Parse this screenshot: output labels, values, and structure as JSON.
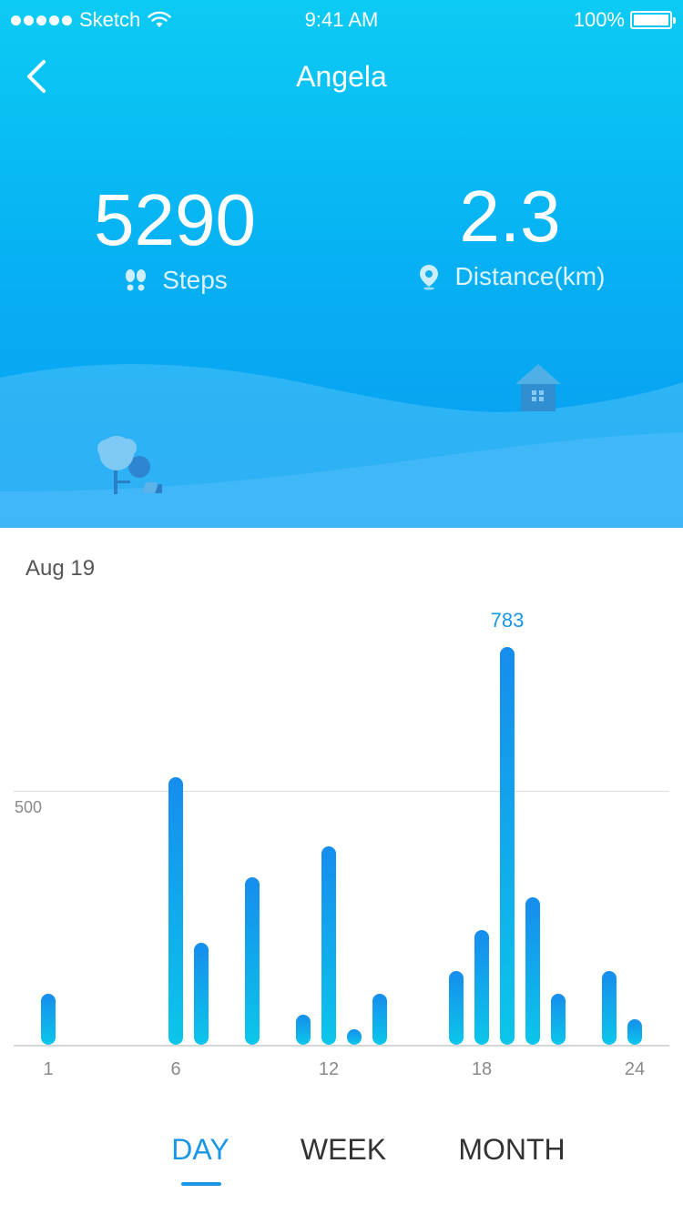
{
  "status_bar": {
    "carrier": "Sketch",
    "time": "9:41 AM",
    "battery": "100%"
  },
  "nav": {
    "title": "Angela",
    "back_icon": "chevron-left-icon"
  },
  "stats": {
    "steps_value": "5290",
    "steps_label": "Steps",
    "steps_icon": "footprints-icon",
    "distance_value": "2.3",
    "distance_label": "Distance(km)",
    "distance_icon": "location-pin-icon"
  },
  "date": "Aug 19",
  "colors": {
    "accent": "#1a96e6",
    "hero_top": "#0ccbf3",
    "hero_bottom": "#0a9af0"
  },
  "chart_data": {
    "type": "bar",
    "x": [
      1,
      6,
      7,
      9,
      11,
      12,
      13,
      14,
      17,
      18,
      19,
      20,
      21,
      23,
      24
    ],
    "values": [
      100,
      527,
      200,
      330,
      60,
      390,
      30,
      100,
      145,
      225,
      783,
      290,
      100,
      145,
      50
    ],
    "x_ticks": [
      "1",
      "6",
      "12",
      "18",
      "24"
    ],
    "y_ticks": [
      "500"
    ],
    "ylim": [
      0,
      783
    ],
    "peak_label": "783",
    "title": "",
    "xlabel": "",
    "ylabel": ""
  },
  "tabs": [
    {
      "label": "DAY",
      "active": true
    },
    {
      "label": "WEEK",
      "active": false
    },
    {
      "label": "MONTH",
      "active": false
    }
  ]
}
